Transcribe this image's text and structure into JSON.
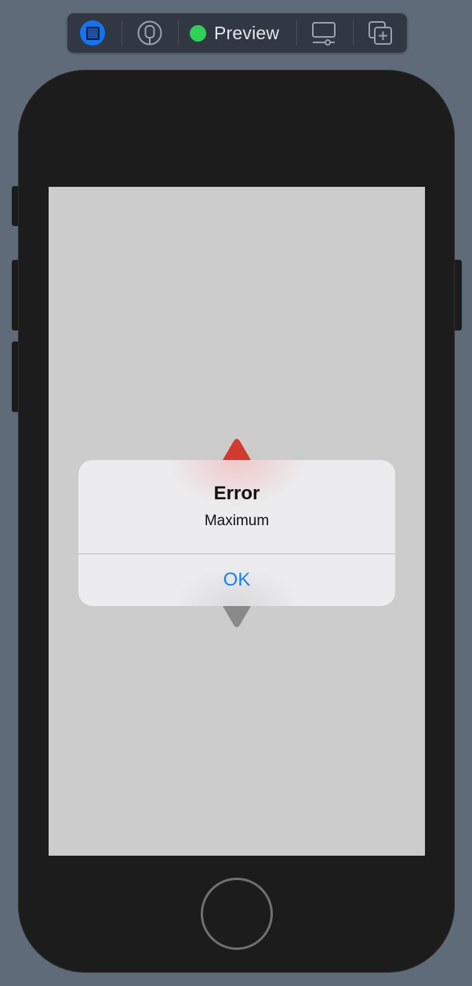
{
  "toolbar": {
    "live_button_icon": "stop-live-preview-icon",
    "pin_icon": "pin-preview-icon",
    "preview_label": "Preview",
    "preview_status_color": "#2fd158",
    "device_settings_icon": "device-settings-icon",
    "duplicate_icon": "duplicate-preview-icon"
  },
  "device": {
    "home_button_icon": "home-button-icon"
  },
  "stepper": {
    "increment_icon": "increment-arrow-icon",
    "increment_color": "#d33a2f",
    "decrement_icon": "decrement-arrow-icon",
    "decrement_color": "#8a8a8a"
  },
  "alert": {
    "title": "Error",
    "message": "Maximum",
    "ok_label": "OK",
    "ok_color": "#1a7ff0"
  }
}
